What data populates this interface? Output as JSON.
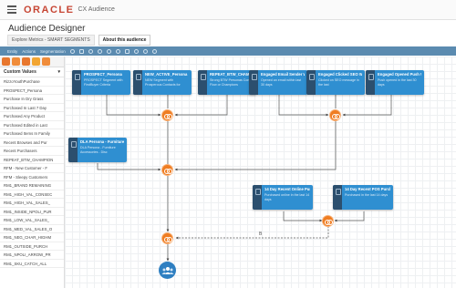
{
  "header": {
    "brand": "ORACLE",
    "product": "CX Audience",
    "menu_icon": "hamburger-icon"
  },
  "page": {
    "title": "Audience Designer",
    "tabs": [
      {
        "label": "Explore Metrics - SMART SEGMENTS",
        "active": false
      },
      {
        "label": "About this audience",
        "active": true
      }
    ]
  },
  "toolbar": {
    "items": [
      "Entity",
      "Actions",
      "Segmentation"
    ],
    "icons": [
      "play-icon",
      "stop-icon",
      "undo-icon",
      "redo-icon",
      "zoom-in-icon",
      "zoom-out-icon",
      "fit-icon",
      "add-user-icon",
      "remove-user-icon",
      "refresh-icon"
    ]
  },
  "left_panel": {
    "palette_icons": [
      "node-add-icon",
      "merge-icon",
      "split-icon",
      "filter-icon",
      "export-icon"
    ],
    "header": "Custom Values",
    "items": [
      "RizzoYouthPurchase",
      "PROSPECT_Persona",
      "Purchase In Dry Grass",
      "Purchased In Last 7 Day",
      "Purchased Any Product",
      "Purchased Edited in Last",
      "Purchased Items In Family",
      "Recent Browses and Pur",
      "Recent Purchasers",
      "REPEAT_BTW_CHAMPION",
      "RFM - New Customer - F",
      "RFM - Sleepy Customers",
      "RM1_BRAND REMAINING",
      "RM1_HIGH_VAL_CONSEC",
      "RM1_HIGH_VAL_SALES_",
      "RM1_INSIDE_NPOLI_PUR",
      "RM1_LOW_VAL_SALES_",
      "RM1_MED_VAL_SALES_O",
      "RM1_NEG_CHAR_HIGHM",
      "RM1_OUTSIDE_PURCH",
      "RM1_NPOLI_ARROW_PR",
      "RM1_SKU_CATCH_ALL"
    ]
  },
  "canvas": {
    "nodes": [
      {
        "title": "PROSPECT_Persona",
        "desc": "PROSPECT Segment with FirstBuyer Criteria"
      },
      {
        "title": "NEW_ACTIVE_Persona",
        "desc": "NEW Segment with Prosperous Contacts for"
      },
      {
        "title": "REPEAT_BTW_CHAMP",
        "desc": "Strong BTW Personas Cont Flow or Champions"
      },
      {
        "title": "Engaged Email Sender Within Last",
        "desc": "Opened an email within last 30 days"
      },
      {
        "title": "Engaged Clicked SEO Within 30 Days",
        "desc": "Clicked on SEO message in the last"
      },
      {
        "title": "Engaged Opened Push Within 30 Days",
        "desc": "Push opened in the last 30 days"
      },
      {
        "title": "DLA Persona - Furniture Accessori",
        "desc": "DLA Persona - Furniture Accessories - Disc"
      },
      {
        "title": "14 Day Recent Online Purchasers",
        "desc": "Purchased online in the last 14 days"
      },
      {
        "title": "14 Day Recent POS Purchasers",
        "desc": "Purchased in the last 14 days"
      }
    ],
    "operators": [
      "merge-icon",
      "merge-icon",
      "merge-icon",
      "merge-icon",
      "merge-icon"
    ],
    "link_label": "B",
    "audience_icon": "audience-group-icon",
    "colors": {
      "node": "#2f8fd1",
      "node_icon": "#2c4f6e",
      "operator": "#ef7d22",
      "audience": "#2e7fc1",
      "toolbar": "#5b8bb0",
      "brand": "#c74634"
    }
  }
}
